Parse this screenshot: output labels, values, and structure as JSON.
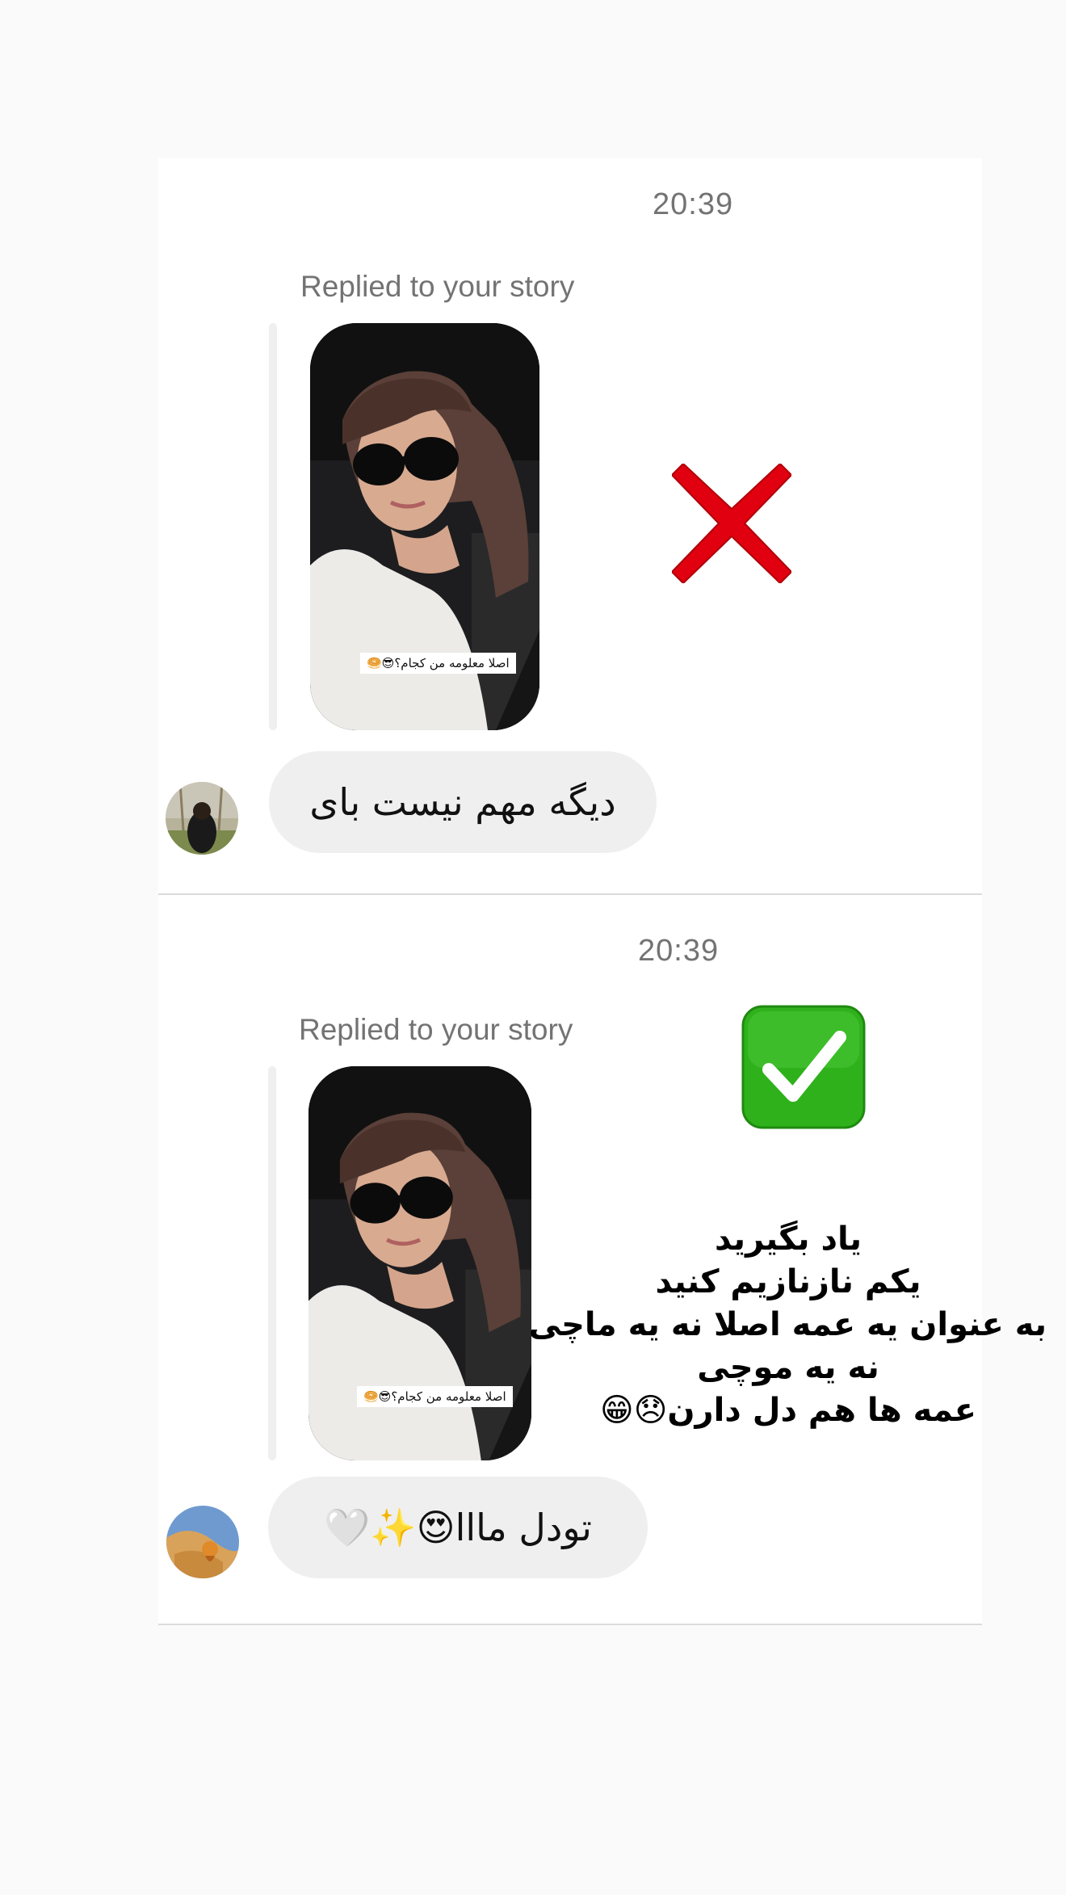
{
  "messages": [
    {
      "timestamp": "20:39",
      "replied_label": "Replied to your story",
      "story_caption": "اصلا معلومه من کجام؟😎🥯",
      "bubble_text": "دیگه مهم نیست بای",
      "verdict_icon": "red-cross-icon"
    },
    {
      "timestamp": "20:39",
      "replied_label": "Replied to your story",
      "story_caption": "اصلا معلومه من کجام؟😎🥯",
      "bubble_text": "تودل مااا😍✨🤍",
      "verdict_icon": "green-check-icon"
    }
  ],
  "overlay_text": {
    "line1": "یاد بگیرید",
    "line2": "یکم نازنازیم کنید",
    "line3": "به عنوان یه عمه اصلا نه یه ماچی",
    "line4": "نه یه موچی",
    "line5": "عمه ها هم دل دارن😞😁"
  },
  "colors": {
    "bubble_bg": "#efefef",
    "muted_text": "#737373",
    "cross_red": "#e0000f",
    "check_green": "#2fb11c"
  }
}
